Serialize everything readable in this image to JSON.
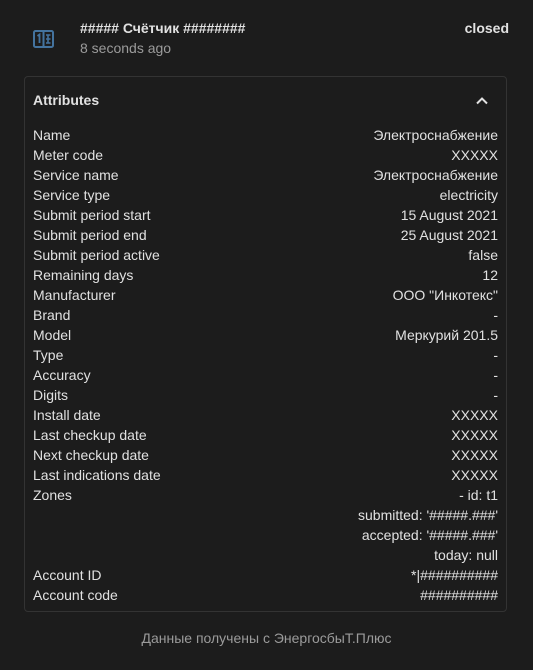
{
  "entity": {
    "icon": "counter-icon",
    "name": "##### Счётчик ########",
    "time": "8 seconds ago",
    "state": "closed"
  },
  "attributes": {
    "title": "Attributes",
    "collapse_icon": "chevron-up-icon",
    "rows": [
      {
        "key": "Name",
        "value": "Электроснабжение"
      },
      {
        "key": "Meter code",
        "value": "XXXXX"
      },
      {
        "key": "Service name",
        "value": "Электроснабжение"
      },
      {
        "key": "Service type",
        "value": "electricity"
      },
      {
        "key": "Submit period start",
        "value": "15 August 2021"
      },
      {
        "key": "Submit period end",
        "value": "25 August 2021"
      },
      {
        "key": "Submit period active",
        "value": "false"
      },
      {
        "key": "Remaining days",
        "value": "12"
      },
      {
        "key": "Manufacturer",
        "value": "ООО \"Инкотекс\""
      },
      {
        "key": "Brand",
        "value": "-"
      },
      {
        "key": "Model",
        "value": "Меркурий 201.5"
      },
      {
        "key": "Type",
        "value": "-"
      },
      {
        "key": "Accuracy",
        "value": "-"
      },
      {
        "key": "Digits",
        "value": "-"
      },
      {
        "key": "Install date",
        "value": "XXXXX"
      },
      {
        "key": "Last checkup date",
        "value": "XXXXX"
      },
      {
        "key": "Next checkup date",
        "value": "XXXXX"
      },
      {
        "key": "Last indications date",
        "value": "XXXXX"
      },
      {
        "key": "Zones",
        "value": "- id: t1"
      },
      {
        "key": "",
        "value": "submitted: '#####.###'"
      },
      {
        "key": "",
        "value": "accepted: '#####.###'"
      },
      {
        "key": "",
        "value": "today: null"
      },
      {
        "key": "Account ID",
        "value": "*|##########"
      },
      {
        "key": "Account code",
        "value": "##########"
      }
    ]
  },
  "footer": {
    "attribution": "Данные получены с ЭнергосбыТ.Плюс"
  }
}
